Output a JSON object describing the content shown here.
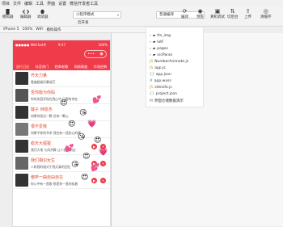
{
  "menubar": {
    "items": [
      "项目",
      "文件",
      "编辑",
      "工具",
      "界面",
      "设置",
      "微信开发者工具"
    ]
  },
  "toolbar": {
    "buttons": [
      {
        "label": "模拟器",
        "icon": "phone-icon"
      },
      {
        "label": "编辑器",
        "icon": "code-icon"
      },
      {
        "label": "调试器",
        "icon": "bug-icon"
      }
    ],
    "mode_select": "小程序模式",
    "mode_sub": "云开发",
    "compile_select": "普通编译",
    "right_buttons": [
      {
        "label": "编译",
        "icon": "refresh-icon"
      },
      {
        "label": "预览",
        "icon": "eye-icon"
      },
      {
        "label": "真机调试",
        "icon": "device-icon"
      },
      {
        "label": "切后台",
        "icon": "switch-icon"
      },
      {
        "label": "清缓存",
        "icon": "clean-icon"
      }
    ],
    "right_labels": [
      "上传",
      "版本管理",
      "详情"
    ]
  },
  "statusbar": {
    "device": "iPhone 5",
    "zoom": "100%",
    "net": "WiFi",
    "action": "模拟操作"
  },
  "phone": {
    "status_left": "●●●●● WeChat令",
    "status_time": "9:37",
    "status_right": "100%",
    "tabs": [
      "流行日历",
      "抖音热门",
      "经典老歌",
      "网络歌曲",
      "华语经典"
    ],
    "rows": [
      {
        "title": "齐天力量",
        "sub": "看遍超级风暴迷茫"
      },
      {
        "title": "否你能为你妈",
        "sub": "你的笑容浮现在我心中 只要有你在"
      },
      {
        "title": "璇子 林俊杰",
        "sub": "如果你身边一颗 总有一颗心"
      },
      {
        "title": "很不爱我",
        "sub": "如果不你再寻求 我也有一段伤心的情"
      },
      {
        "title": "稳天大猩猩",
        "sub": "我们大地 与风共舞 让人望不到边"
      },
      {
        "title": "我们相识女生",
        "sub": "人和我的相对于我天真的回忆"
      },
      {
        "title": "傻萨一曲自由自在",
        "sub": "你心中有一首歌 那是你一直的执着"
      }
    ]
  },
  "filetree": {
    "items": [
      {
        "label": "fm_img",
        "type": "folder"
      },
      {
        "label": "lotF",
        "type": "folder"
      },
      {
        "label": "pages",
        "type": "folder"
      },
      {
        "label": "srcParse",
        "type": "folder"
      },
      {
        "label": "NumberAnimate.js",
        "type": "js"
      },
      {
        "label": "app.js",
        "type": "js"
      },
      {
        "label": "app.json",
        "type": "json"
      },
      {
        "label": "app.wxss",
        "type": "wxss"
      },
      {
        "label": "siteinfo.js",
        "type": "js"
      },
      {
        "label": "project.json",
        "type": "json"
      },
      {
        "label": "界面仓储数据演示",
        "type": "md"
      }
    ]
  }
}
